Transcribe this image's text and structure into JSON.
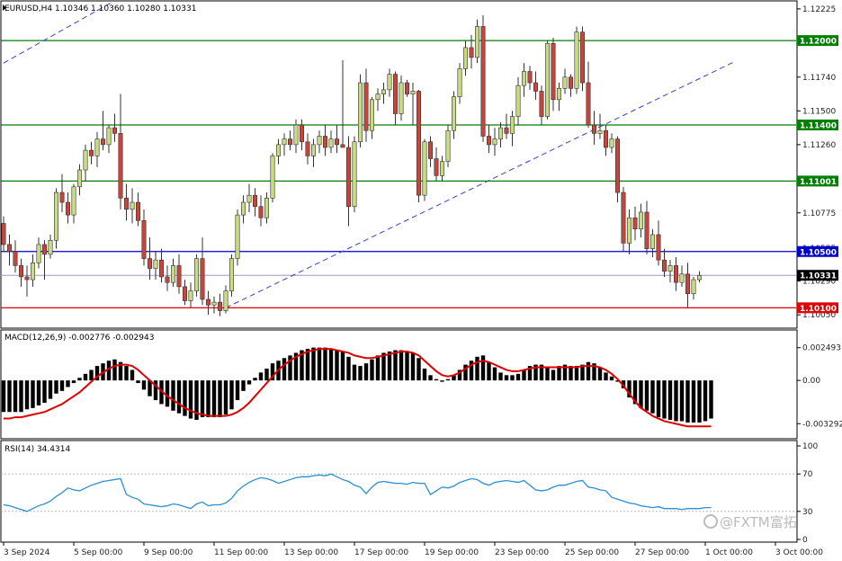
{
  "chart_data": {
    "type": "candlestick",
    "symbol_header": "EURUSD,H4  1.10346 1.10360 1.10280 1.10331",
    "price_axis": {
      "ticks": [
        "1.12225",
        "1.11740",
        "1.11500",
        "1.11260",
        "1.10775",
        "1.10525",
        "1.10290",
        "1.10050"
      ],
      "tick_values": [
        1.12225,
        1.1174,
        1.115,
        1.1126,
        1.10775,
        1.10525,
        1.1029,
        1.1005
      ],
      "range": [
        1.1,
        1.1225
      ]
    },
    "level_tags": [
      {
        "text": "1.12000",
        "value": 1.12,
        "color": "#008000"
      },
      {
        "text": "1.11400",
        "value": 1.114,
        "color": "#008000"
      },
      {
        "text": "1.11001",
        "value": 1.11001,
        "color": "#008000"
      },
      {
        "text": "1.10500",
        "value": 1.105,
        "color": "#0000cc"
      },
      {
        "text": "1.10331",
        "value": 1.10331,
        "color": "#000000"
      },
      {
        "text": "1.10100",
        "value": 1.101,
        "color": "#e00000"
      }
    ],
    "candles": [
      [
        1.107,
        1.1075,
        1.105,
        1.1055
      ],
      [
        1.1055,
        1.1062,
        1.104,
        1.105
      ],
      [
        1.105,
        1.1058,
        1.1035,
        1.104
      ],
      [
        1.104,
        1.1045,
        1.1025,
        1.1032
      ],
      [
        1.1032,
        1.104,
        1.1018,
        1.103
      ],
      [
        1.103,
        1.1048,
        1.1025,
        1.1042
      ],
      [
        1.1042,
        1.106,
        1.1038,
        1.1055
      ],
      [
        1.1055,
        1.1058,
        1.103,
        1.1048
      ],
      [
        1.1048,
        1.1062,
        1.1045,
        1.1058
      ],
      [
        1.1058,
        1.1095,
        1.1052,
        1.1092
      ],
      [
        1.1092,
        1.1105,
        1.1078,
        1.1085
      ],
      [
        1.1085,
        1.1092,
        1.107,
        1.1076
      ],
      [
        1.1076,
        1.1098,
        1.107,
        1.1096
      ],
      [
        1.1096,
        1.1112,
        1.109,
        1.1108
      ],
      [
        1.1108,
        1.1126,
        1.11,
        1.1122
      ],
      [
        1.1122,
        1.1128,
        1.1112,
        1.1118
      ],
      [
        1.1118,
        1.1135,
        1.111,
        1.113
      ],
      [
        1.113,
        1.115,
        1.1122,
        1.1126
      ],
      [
        1.1126,
        1.114,
        1.112,
        1.1138
      ],
      [
        1.1138,
        1.1148,
        1.1128,
        1.1134
      ],
      [
        1.1134,
        1.1162,
        1.108,
        1.1088
      ],
      [
        1.1088,
        1.1098,
        1.1072,
        1.108
      ],
      [
        1.108,
        1.1095,
        1.107,
        1.1085
      ],
      [
        1.1085,
        1.1092,
        1.1068,
        1.1072
      ],
      [
        1.1072,
        1.108,
        1.104,
        1.1045
      ],
      [
        1.1045,
        1.106,
        1.103,
        1.1038
      ],
      [
        1.1038,
        1.105,
        1.103,
        1.1044
      ],
      [
        1.1044,
        1.1052,
        1.1028,
        1.1032
      ],
      [
        1.1032,
        1.104,
        1.1022,
        1.1028
      ],
      [
        1.1028,
        1.1045,
        1.1025,
        1.104
      ],
      [
        1.104,
        1.1048,
        1.102,
        1.1025
      ],
      [
        1.1025,
        1.103,
        1.1012,
        1.1015
      ],
      [
        1.1015,
        1.1028,
        1.101,
        1.1022
      ],
      [
        1.1022,
        1.1048,
        1.1018,
        1.1045
      ],
      [
        1.1045,
        1.106,
        1.1012,
        1.1016
      ],
      [
        1.1016,
        1.1022,
        1.1005,
        1.1012
      ],
      [
        1.1012,
        1.1018,
        1.1006,
        1.1014
      ],
      [
        1.1014,
        1.102,
        1.1004,
        1.1008
      ],
      [
        1.1008,
        1.1026,
        1.1006,
        1.1022
      ],
      [
        1.1022,
        1.1048,
        1.1018,
        1.1045
      ],
      [
        1.1045,
        1.108,
        1.104,
        1.1076
      ],
      [
        1.1076,
        1.109,
        1.107,
        1.1085
      ],
      [
        1.1085,
        1.1098,
        1.1078,
        1.109
      ],
      [
        1.109,
        1.1095,
        1.1075,
        1.1082
      ],
      [
        1.1082,
        1.109,
        1.1068,
        1.1074
      ],
      [
        1.1074,
        1.1092,
        1.107,
        1.1088
      ],
      [
        1.1088,
        1.112,
        1.1085,
        1.1118
      ],
      [
        1.1118,
        1.113,
        1.1112,
        1.1126
      ],
      [
        1.1126,
        1.1134,
        1.1118,
        1.113
      ],
      [
        1.113,
        1.1136,
        1.1122,
        1.1126
      ],
      [
        1.1126,
        1.1144,
        1.112,
        1.114
      ],
      [
        1.114,
        1.1144,
        1.1122,
        1.1128
      ],
      [
        1.1128,
        1.1134,
        1.1112,
        1.1118
      ],
      [
        1.1118,
        1.113,
        1.111,
        1.1126
      ],
      [
        1.1126,
        1.1136,
        1.112,
        1.1132
      ],
      [
        1.1132,
        1.114,
        1.1118,
        1.1124
      ],
      [
        1.1124,
        1.1136,
        1.112,
        1.113
      ],
      [
        1.113,
        1.114,
        1.112,
        1.1126
      ],
      [
        1.1126,
        1.1186,
        1.1124,
        1.1124
      ],
      [
        1.1124,
        1.1132,
        1.1068,
        1.1082
      ],
      [
        1.1082,
        1.1132,
        1.1078,
        1.1128
      ],
      [
        1.1128,
        1.1176,
        1.1124,
        1.117
      ],
      [
        1.117,
        1.118,
        1.1128,
        1.1136
      ],
      [
        1.1136,
        1.116,
        1.113,
        1.1158
      ],
      [
        1.1158,
        1.1166,
        1.115,
        1.1162
      ],
      [
        1.1162,
        1.117,
        1.1155,
        1.1165
      ],
      [
        1.1165,
        1.118,
        1.116,
        1.1176
      ],
      [
        1.1176,
        1.1178,
        1.114,
        1.1148
      ],
      [
        1.1148,
        1.1175,
        1.1143,
        1.117
      ],
      [
        1.117,
        1.1172,
        1.116,
        1.1162
      ],
      [
        1.1162,
        1.117,
        1.114,
        1.1164
      ],
      [
        1.1164,
        1.1165,
        1.1085,
        1.109
      ],
      [
        1.109,
        1.113,
        1.1086,
        1.1128
      ],
      [
        1.1128,
        1.1132,
        1.111,
        1.1116
      ],
      [
        1.1116,
        1.1124,
        1.11,
        1.1104
      ],
      [
        1.1104,
        1.1118,
        1.11,
        1.1114
      ],
      [
        1.1114,
        1.114,
        1.111,
        1.1136
      ],
      [
        1.1136,
        1.1164,
        1.113,
        1.116
      ],
      [
        1.116,
        1.1184,
        1.1155,
        1.118
      ],
      [
        1.118,
        1.12,
        1.1175,
        1.1195
      ],
      [
        1.1195,
        1.1204,
        1.118,
        1.1188
      ],
      [
        1.1188,
        1.1215,
        1.1184,
        1.121
      ],
      [
        1.121,
        1.1218,
        1.1128,
        1.1132
      ],
      [
        1.1132,
        1.114,
        1.112,
        1.1126
      ],
      [
        1.1126,
        1.1138,
        1.1118,
        1.113
      ],
      [
        1.113,
        1.1142,
        1.1124,
        1.1138
      ],
      [
        1.1138,
        1.1148,
        1.113,
        1.1134
      ],
      [
        1.1134,
        1.115,
        1.1125,
        1.1146
      ],
      [
        1.1146,
        1.1174,
        1.114,
        1.1168
      ],
      [
        1.1168,
        1.1184,
        1.116,
        1.1178
      ],
      [
        1.1178,
        1.1182,
        1.1165,
        1.117
      ],
      [
        1.117,
        1.1178,
        1.1158,
        1.1164
      ],
      [
        1.1164,
        1.1168,
        1.114,
        1.1146
      ],
      [
        1.1146,
        1.12,
        1.1144,
        1.1198
      ],
      [
        1.1198,
        1.1202,
        1.115,
        1.1158
      ],
      [
        1.1158,
        1.117,
        1.115,
        1.1166
      ],
      [
        1.1166,
        1.118,
        1.1162,
        1.1174
      ],
      [
        1.1174,
        1.1176,
        1.116,
        1.1166
      ],
      [
        1.1166,
        1.121,
        1.1162,
        1.1206
      ],
      [
        1.1206,
        1.121,
        1.1164,
        1.117
      ],
      [
        1.117,
        1.1185,
        1.1138,
        1.114
      ],
      [
        1.114,
        1.115,
        1.1126,
        1.1134
      ],
      [
        1.1134,
        1.1148,
        1.113,
        1.1136
      ],
      [
        1.1136,
        1.114,
        1.1118,
        1.1124
      ],
      [
        1.1124,
        1.1134,
        1.112,
        1.113
      ],
      [
        1.113,
        1.1132,
        1.1085,
        1.1092
      ],
      [
        1.1092,
        1.1096,
        1.105,
        1.1056
      ],
      [
        1.1056,
        1.108,
        1.1048,
        1.1074
      ],
      [
        1.1074,
        1.1082,
        1.1058,
        1.1066
      ],
      [
        1.1066,
        1.1084,
        1.106,
        1.1078
      ],
      [
        1.1078,
        1.1086,
        1.1048,
        1.1052
      ],
      [
        1.1052,
        1.1066,
        1.1046,
        1.1062
      ],
      [
        1.1062,
        1.1072,
        1.104,
        1.1044
      ],
      [
        1.1044,
        1.1052,
        1.1032,
        1.1036
      ],
      [
        1.1036,
        1.1044,
        1.1028,
        1.104
      ],
      [
        1.104,
        1.1046,
        1.1022,
        1.1028
      ],
      [
        1.1028,
        1.104,
        1.1025,
        1.1034
      ],
      [
        1.1034,
        1.1042,
        1.101,
        1.102
      ],
      [
        1.102,
        1.1032,
        1.1016,
        1.103
      ],
      [
        1.103,
        1.1036,
        1.1028,
        1.1033
      ]
    ],
    "horizontal_levels": [
      {
        "value": 1.12,
        "color": "#008000"
      },
      {
        "value": 1.114,
        "color": "#008000"
      },
      {
        "value": 1.11001,
        "color": "#008000"
      },
      {
        "value": 1.105,
        "color": "#0000cc"
      },
      {
        "value": 1.10331,
        "color": "#9999cc"
      },
      {
        "value": 1.101,
        "color": "#e00000"
      }
    ],
    "trendlines": [
      {
        "from": [
          0,
          1.1184
        ],
        "to": [
          24,
          1.124
        ],
        "color": "#3344cc"
      },
      {
        "from": [
          38,
          1.101
        ],
        "to": [
          125,
          1.1185
        ],
        "color": "#3344cc"
      }
    ],
    "macd": {
      "title": "MACD(12,26,9) -0.002776 -0.002943",
      "ticks": [
        "0.002493",
        "0.00",
        "-0.003292"
      ],
      "tick_values": [
        0.002493,
        0,
        -0.003292
      ],
      "range": [
        -0.0043,
        0.0035
      ],
      "histogram": [
        -0.0024,
        -0.0024,
        -0.0024,
        -0.0024,
        -0.0022,
        -0.0021,
        -0.0019,
        -0.0017,
        -0.0014,
        -0.001,
        -0.0008,
        -0.0005,
        -0.0002,
        0.0002,
        0.0005,
        0.0008,
        0.0011,
        0.0013,
        0.0015,
        0.0016,
        0.0014,
        0.0011,
        0.0008,
        -0.0002,
        -0.0007,
        -0.0012,
        -0.0015,
        -0.0018,
        -0.002,
        -0.0023,
        -0.0025,
        -0.0027,
        -0.0029,
        -0.003,
        -0.0028,
        -0.0028,
        -0.0028,
        -0.0028,
        -0.0026,
        -0.0022,
        -0.0015,
        -0.0008,
        -0.0003,
        0.0002,
        0.0006,
        0.0009,
        0.0013,
        0.0015,
        0.0017,
        0.0019,
        0.0021,
        0.0023,
        0.0024,
        0.0025,
        0.0025,
        0.0025,
        0.0024,
        0.0023,
        0.0022,
        0.0018,
        0.0012,
        0.0011,
        0.0013,
        0.0016,
        0.0019,
        0.0021,
        0.0022,
        0.0023,
        0.0023,
        0.0022,
        0.0021,
        0.0017,
        0.0009,
        0.0004,
        0.0001,
        -0.0001,
        0.0001,
        0.0004,
        0.0008,
        0.0012,
        0.0015,
        0.0018,
        0.0019,
        0.0014,
        0.001,
        0.0006,
        0.0004,
        0.0004,
        0.0005,
        0.0008,
        0.0011,
        0.0012,
        0.0012,
        0.001,
        0.0008,
        0.0011,
        0.0012,
        0.0011,
        0.0011,
        0.0012,
        0.0014,
        0.0013,
        0.001,
        0.0006,
        0.0003,
        -0.0001,
        -0.0006,
        -0.0013,
        -0.0018,
        -0.0021,
        -0.0023,
        -0.0025,
        -0.0028,
        -0.0029,
        -0.003,
        -0.0031,
        -0.0031,
        -0.0032,
        -0.0032,
        -0.0032,
        -0.0031,
        -0.0029
      ],
      "signal": [
        -0.0029,
        -0.0029,
        -0.0028,
        -0.0028,
        -0.0027,
        -0.0026,
        -0.0025,
        -0.0024,
        -0.0022,
        -0.002,
        -0.0018,
        -0.0015,
        -0.0012,
        -0.0009,
        -0.0005,
        -0.0001,
        0.0003,
        0.0006,
        0.0009,
        0.0011,
        0.0012,
        0.0012,
        0.0011,
        0.0008,
        0.0004,
        0.0,
        -0.0004,
        -0.0008,
        -0.0012,
        -0.0015,
        -0.0018,
        -0.0021,
        -0.0023,
        -0.0025,
        -0.0026,
        -0.0027,
        -0.0027,
        -0.0027,
        -0.0027,
        -0.0026,
        -0.0024,
        -0.0021,
        -0.0017,
        -0.0012,
        -0.0007,
        -0.0002,
        0.0003,
        0.0008,
        0.0012,
        0.0015,
        0.0018,
        0.002,
        0.0022,
        0.0023,
        0.0024,
        0.0024,
        0.0024,
        0.0023,
        0.0022,
        0.0021,
        0.0019,
        0.0018,
        0.0017,
        0.0017,
        0.0018,
        0.0019,
        0.002,
        0.0021,
        0.0022,
        0.0022,
        0.0021,
        0.0019,
        0.0015,
        0.0011,
        0.0007,
        0.0004,
        0.0003,
        0.0004,
        0.0006,
        0.0009,
        0.0012,
        0.0014,
        0.0015,
        0.0014,
        0.0012,
        0.001,
        0.0008,
        0.0007,
        0.0007,
        0.0008,
        0.0009,
        0.001,
        0.001,
        0.001,
        0.001,
        0.001,
        0.001,
        0.001,
        0.001,
        0.0011,
        0.0011,
        0.0011,
        0.001,
        0.0008,
        0.0005,
        0.0001,
        -0.0004,
        -0.001,
        -0.0016,
        -0.0021,
        -0.0024,
        -0.0027,
        -0.0029,
        -0.0031,
        -0.0032,
        -0.0033,
        -0.0034,
        -0.0035,
        -0.0035,
        -0.0035,
        -0.0035,
        -0.0035
      ]
    },
    "rsi": {
      "title": "RSI(14) 34.4314",
      "ticks": [
        "100",
        "70",
        "30",
        "0"
      ],
      "tick_values": [
        100,
        70,
        30,
        0
      ],
      "range": [
        0,
        100
      ],
      "levels": [
        70,
        30
      ],
      "values": [
        37,
        36,
        34,
        32,
        30,
        33,
        36,
        38,
        41,
        46,
        50,
        55,
        53,
        52,
        55,
        58,
        60,
        62,
        63,
        64,
        65,
        48,
        45,
        43,
        38,
        37,
        36,
        35,
        36,
        38,
        37,
        35,
        33,
        38,
        40,
        36,
        37,
        37,
        39,
        44,
        52,
        57,
        61,
        64,
        66,
        65,
        63,
        60,
        62,
        64,
        66,
        67,
        67,
        68,
        69,
        68,
        70,
        67,
        64,
        62,
        58,
        56,
        49,
        56,
        61,
        62,
        61,
        60,
        60,
        59,
        61,
        60,
        60,
        48,
        52,
        56,
        55,
        57,
        61,
        63,
        65,
        64,
        60,
        58,
        61,
        62,
        63,
        62,
        61,
        63,
        58,
        53,
        52,
        53,
        56,
        58,
        58,
        60,
        62,
        63,
        56,
        55,
        53,
        52,
        45,
        43,
        41,
        39,
        38,
        36,
        35,
        34,
        35,
        33,
        33,
        33,
        32,
        33,
        33,
        33,
        34,
        34
      ]
    },
    "x_axis": {
      "labels": [
        "3 Sep 2024",
        "5 Sep 00:00",
        "9 Sep 00:00",
        "11 Sep 00:00",
        "13 Sep 00:00",
        "17 Sep 00:00",
        "19 Sep 00:00",
        "23 Sep 00:00",
        "25 Sep 00:00",
        "27 Sep 00:00",
        "1 Oct 00:00",
        "3 Oct 00:00"
      ],
      "label_indices": [
        0,
        12,
        24,
        36,
        48,
        60,
        72,
        84,
        96,
        108,
        120,
        132
      ]
    },
    "colors": {
      "bull": "#c8dc82",
      "bear": "#c8453c",
      "wick": "#333333",
      "macd_hist": "#000000",
      "macd_signal": "#e00000",
      "rsi_line": "#2a8fd4",
      "grid_level": "#aaaaaa"
    }
  },
  "watermark": {
    "text": "@FXTM富拓",
    "icon": "fxtm-logo-icon"
  }
}
